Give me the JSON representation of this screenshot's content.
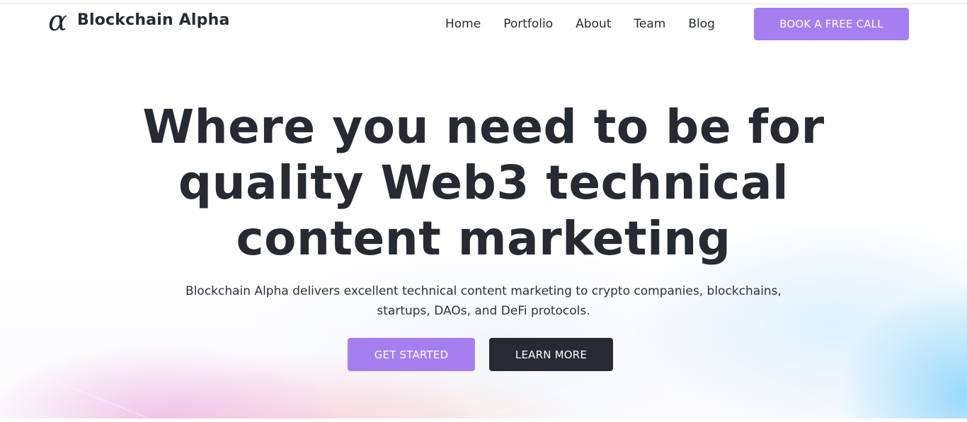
{
  "brand": {
    "icon_glyph": "α",
    "icon": "alpha-logo-icon",
    "name": "Blockchain Alpha"
  },
  "nav": {
    "items": [
      {
        "label": "Home"
      },
      {
        "label": "Portfolio"
      },
      {
        "label": "About"
      },
      {
        "label": "Team"
      },
      {
        "label": "Blog"
      }
    ],
    "cta_label": "BOOK A FREE CALL"
  },
  "hero": {
    "headline_lines": [
      "Where you need to be for",
      "quality Web3 technical",
      "content marketing"
    ],
    "subtitle_lines": [
      "Blockchain Alpha delivers excellent technical content marketing to crypto companies, blockchains,",
      "startups, DAOs, and DeFi protocols."
    ],
    "primary_button": "GET STARTED",
    "secondary_button": "LEARN MORE"
  },
  "colors": {
    "accent": "#a57ff0",
    "dark": "#262b33",
    "background": "#ffffff"
  }
}
